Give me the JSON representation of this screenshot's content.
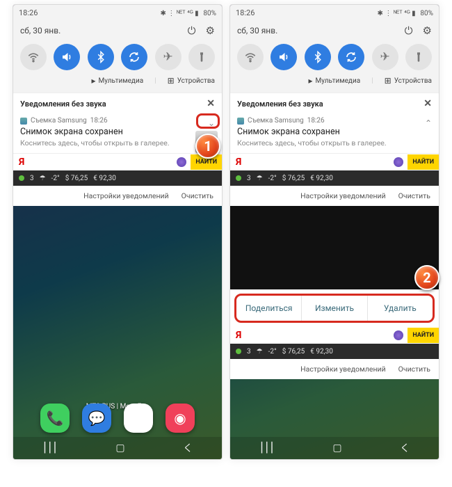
{
  "status": {
    "time": "18:26",
    "net": "80%",
    "icons": "✱ ⋮ ᴺᴱᵀ ⁴ᴳ ▮"
  },
  "shade": {
    "date": "сб, 30 янв.",
    "media": "Мультимедиа",
    "devices": "Устройства"
  },
  "silent": {
    "label": "Уведомления без звука",
    "close": "✕"
  },
  "notif": {
    "app": "Съемка Samsung",
    "time": "18:26",
    "title": "Снимок экрана сохранен",
    "sub": "Коснитесь здесь, чтобы открыть в галерее."
  },
  "yandex": {
    "logo": "Я",
    "find": "НАЙТИ"
  },
  "weather": {
    "count": "3",
    "temp": "-2°",
    "usd": "$ 76,25",
    "eur": "€ 92,30"
  },
  "footer": {
    "settings": "Настройки уведомлений",
    "clear": "Очистить"
  },
  "actions": {
    "share": "Поделиться",
    "edit": "Изменить",
    "del": "Удалить"
  },
  "carrier": "MTS RUS | MegaFon",
  "badges": {
    "one": "1",
    "two": "2"
  }
}
